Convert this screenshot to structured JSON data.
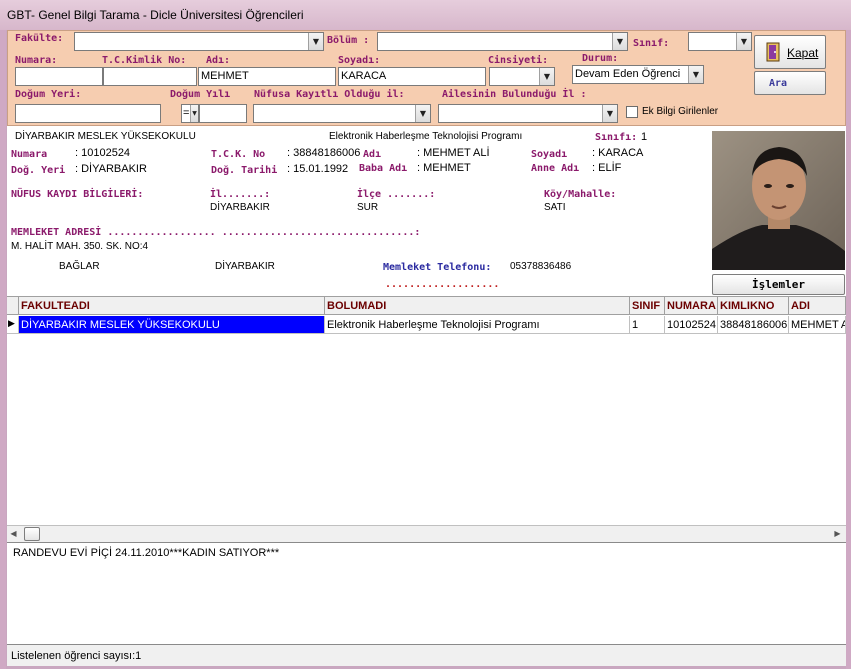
{
  "window": {
    "title": "GBT- Genel Bilgi Tarama - Dicle Üniversitesi Öğrencileri"
  },
  "filters": {
    "fakulte_label": "Fakülte:",
    "fakulte_value": "",
    "bolum_label": "Bölüm :",
    "bolum_value": "",
    "sinif_label": "Sınıf:",
    "sinif_value": "",
    "numara_label": "Numara:",
    "numara_value": "",
    "tc_label": "T.C.Kimlik No:",
    "tc_value": "",
    "adi_label": "Adı:",
    "adi_value": "MEHMET",
    "soyadi_label": "Soyadı:",
    "soyadi_value": "KARACA",
    "cinsiyet_label": "Cinsiyeti:",
    "cinsiyet_value": "",
    "durum_label": "Durum:",
    "durum_value": "Devam Eden Öğrenci",
    "dogum_yeri_label": "Doğum Yeri:",
    "dogum_yeri_value": "",
    "dogum_yili_label": "Doğum Yılı",
    "dogum_yili_op": "=",
    "dogum_yili_value": "",
    "nufus_il_label": "Nüfusa Kayıtlı Olduğu il:",
    "nufus_il_value": "",
    "aile_il_label": "Ailesinin Bulunduğu İl :",
    "aile_il_value": "",
    "ek_bilgi_label": "Ek Bilgi Girilenler"
  },
  "buttons": {
    "kapat": "Kapat",
    "ara": "Ara",
    "islemler": "İşlemler"
  },
  "detail": {
    "faculty": "DİYARBAKIR MESLEK YÜKSEKOKULU",
    "program": "Elektronik Haberleşme Teknolojisi Programı",
    "sinif_label": "Sınıfı:",
    "sinif_value": "1",
    "numara_label": "Numara",
    "numara_value": ": 10102524",
    "tck_label": "T.C.K. No",
    "tck_value": ": 38848186006",
    "adi_label": "Adı",
    "adi_value": ": MEHMET ALİ",
    "soyadi_label": "Soyadı",
    "soyadi_value": ": KARACA",
    "dog_yeri_label": "Doğ. Yeri",
    "dog_yeri_value": ": DİYARBAKIR",
    "dog_tarihi_label": "Doğ. Tarihi",
    "dog_tarihi_value": ": 15.01.1992",
    "baba_label": "Baba Adı",
    "baba_value": ": MEHMET",
    "anne_label": "Anne Adı",
    "anne_value": ": ELİF",
    "nufus_title": "NÜFUS KAYDI BİLGİLERİ:",
    "il_label": "İl.......:",
    "il_value": "DİYARBAKIR",
    "ilce_label": "İlçe .......:",
    "ilce_value": "SUR",
    "koy_label": "Köy/Mahalle:",
    "koy_value": "SATI",
    "memleket_title": "MEMLEKET ADRESİ  .................. ................................:",
    "adres_line1": "M. HALİT MAH. 350. SK. NO:4",
    "adres_ilce": "BAĞLAR",
    "adres_il": "DİYARBAKIR",
    "tel_label": "Memleket Telefonu:",
    "tel_value": "05378836486",
    "tel_dots": "..................."
  },
  "grid": {
    "headers": [
      "FAKULTEADI",
      "BOLUMADI",
      "SINIF",
      "NUMARA",
      "KIMLIKNO",
      "ADI"
    ],
    "rows": [
      [
        "DİYARBAKIR MESLEK YÜKSEKOKULU",
        "Elektronik Haberleşme Teknolojisi Programı",
        "1",
        "10102524",
        "38848186006",
        "MEHMET ALİ"
      ]
    ]
  },
  "memo": {
    "text": "RANDEVU EVİ  PİÇİ 24.11.2010***KADIN SATIYOR***"
  },
  "status": {
    "text": "Listelenen öğrenci sayısı:1"
  }
}
